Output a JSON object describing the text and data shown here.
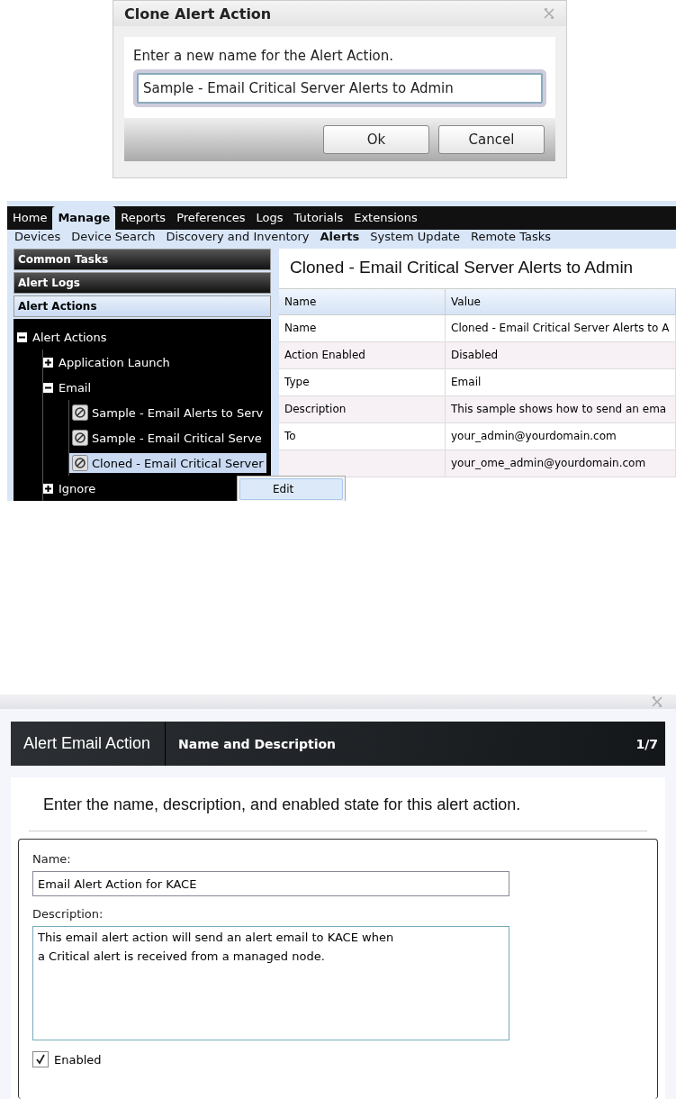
{
  "clone_dialog": {
    "title": "Clone Alert Action",
    "prompt": "Enter a new name for the Alert Action.",
    "name_field": {
      "value": "Sample - Email Critical Server Alerts to Admin"
    },
    "buttons": [
      "Ok",
      "Cancel"
    ]
  },
  "console": {
    "main_tabs": [
      {
        "label": "Home",
        "selected": false
      },
      {
        "label": "Manage",
        "selected": true
      },
      {
        "label": "Reports",
        "selected": false
      },
      {
        "label": "Preferences",
        "selected": false
      },
      {
        "label": "Logs",
        "selected": false
      },
      {
        "label": "Tutorials",
        "selected": false
      },
      {
        "label": "Extensions",
        "selected": false
      }
    ],
    "sub_tabs": [
      {
        "label": "Devices",
        "selected": false
      },
      {
        "label": "Device Search",
        "selected": false
      },
      {
        "label": "Discovery and Inventory",
        "selected": false
      },
      {
        "label": "Alerts",
        "selected": true
      },
      {
        "label": "System Update",
        "selected": false
      },
      {
        "label": "Remote Tasks",
        "selected": false
      }
    ],
    "sections": [
      {
        "label": "Common Tasks",
        "expanded": false
      },
      {
        "label": "Alert Logs",
        "expanded": false
      },
      {
        "label": "Alert Actions",
        "expanded": true
      }
    ],
    "tree": [
      {
        "label": "Alert Actions",
        "expanded": true,
        "children": [
          {
            "label": "Application Launch",
            "expanded": false
          },
          {
            "label": "Email",
            "expanded": true,
            "children": [
              {
                "label": "Sample - Email Alerts to Serv",
                "selected": false
              },
              {
                "label": "Sample - Email Critical Serve",
                "selected": false
              },
              {
                "label": "Cloned - Email Critical Server",
                "selected": true
              }
            ]
          },
          {
            "label": "Ignore",
            "expanded": false
          }
        ]
      }
    ],
    "context_menu": [
      "Edit"
    ],
    "detail_title": "Cloned - Email Critical Server Alerts to Admin",
    "table": {
      "columns": [
        "Name",
        "Value"
      ],
      "rows": [
        {
          "name": "Name",
          "value": "Cloned - Email Critical Server Alerts to A"
        },
        {
          "name": "Action Enabled",
          "value": "Disabled"
        },
        {
          "name": "Type",
          "value": "Email"
        },
        {
          "name": "Description",
          "value": "This sample shows how to send an ema"
        },
        {
          "name": "To",
          "value": "your_admin@yourdomain.com"
        },
        {
          "value": "your_ome_admin@yourdomain.com"
        }
      ]
    }
  },
  "wizard": {
    "title": "Alert Email Action",
    "step": "Name and Description",
    "progress": "1/7",
    "instruction": "Enter the name, description, and enabled state for this alert action.",
    "name_label": "Name:",
    "name_value": "Email Alert Action for KACE",
    "description_label": "Description:",
    "description_value": "This email alert action will send an alert email to KACE when a Critical alert is received from a managed node.",
    "enabled": {
      "label": "Enabled",
      "checked": true
    }
  }
}
